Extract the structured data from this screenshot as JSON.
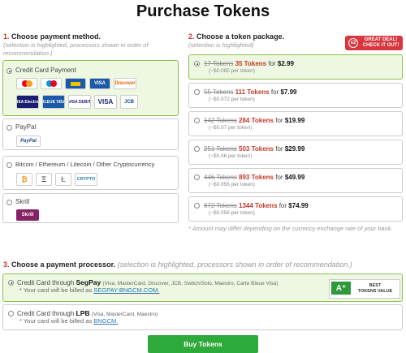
{
  "title": "Purchase Tokens",
  "section1": {
    "num": "1.",
    "label": "Choose payment method.",
    "hint": "(selection is highlighted, processors shown in order of recommendation.)"
  },
  "section2": {
    "num": "2.",
    "label": "Choose a token package.",
    "hint": "(selection is highlighted)"
  },
  "section3": {
    "num": "3.",
    "label": "Choose a payment processor.",
    "hint": "(selection is highlighted, processors shown in order of recommendation.)"
  },
  "great_deal": {
    "badge": "x2",
    "line1": "GREAT DEAL!",
    "line2": "CHECK IT OUT!"
  },
  "methods": [
    {
      "label": "Credit Card Payment",
      "selected": true
    },
    {
      "label": "PayPal",
      "selected": false
    },
    {
      "label": "Bitcoin / Ethereum / Litecoin / Other Cryptocurrency",
      "selected": false
    },
    {
      "label": "Skrill",
      "selected": false
    }
  ],
  "card_logos": [
    "MasterCard",
    "Maestro",
    "Discover",
    "VISA Electron",
    "BLEUE VISA",
    "VISA DEBIT",
    "VISA",
    "JCB"
  ],
  "card_logo_colors": [
    "#f79e1b",
    "#cc0000",
    "#1a1f71",
    "#e65c00",
    "#1a1f71",
    "#1a1f71",
    "#1a1f71",
    "#1a1f71",
    "#1a1f71",
    "#0e4c96"
  ],
  "paypal_logo": "PayPal",
  "crypto_logos": [
    "₿",
    "Ξ",
    "Ł",
    "CRYPTO"
  ],
  "skrill_logo": "Skrill",
  "packages": [
    {
      "old": "17 Tokens",
      "tokens": "35 Tokens",
      "for": "for",
      "price": "$2.99",
      "per": "(~$0.085 per token)",
      "selected": true
    },
    {
      "old": "55 Tokens",
      "tokens": "111 Tokens",
      "for": "for",
      "price": "$7.99",
      "per": "(~$0.072 per token)",
      "selected": false
    },
    {
      "old": "142 Tokens",
      "tokens": "284 Tokens",
      "for": "for",
      "price": "$19.99",
      "per": "(~$0.07 per token)",
      "selected": false
    },
    {
      "old": "251 Tokens",
      "tokens": "503 Tokens",
      "for": "for",
      "price": "$29.99",
      "per": "(~$0.06 per token)",
      "selected": false
    },
    {
      "old": "446 Tokens",
      "tokens": "893 Tokens",
      "for": "for",
      "price": "$49.99",
      "per": "(~$0.056 per token)",
      "selected": false
    },
    {
      "old": "672 Tokens",
      "tokens": "1344 Tokens",
      "for": "for",
      "price": "$74.99",
      "per": "(~$0.056 per token)",
      "selected": false
    }
  ],
  "amount_note": "* Amount may differ depending on the currency exchange rate of your bank.",
  "processors": [
    {
      "pre": "Credit Card through",
      "name": "SegPay",
      "cards": "(Visa, MasterCard, Discover, JCB, Switch/Solo, Maestro, Carte Bleue Visa)",
      "billed": "* Your card will be billed as",
      "billed_name": "SEGPAY-BNGCM.COM.",
      "selected": true
    },
    {
      "pre": "Credit Card through",
      "name": "LPB",
      "cards": "(Visa, MasterCard, Maestro)",
      "billed": "* Your card will be billed as",
      "billed_name": "BNGCM.",
      "selected": false
    }
  ],
  "best_value": {
    "icon": "A⁺",
    "line1": "BEST",
    "line2": "TOKENS VALUE"
  },
  "buy_button": "Buy Tokens"
}
